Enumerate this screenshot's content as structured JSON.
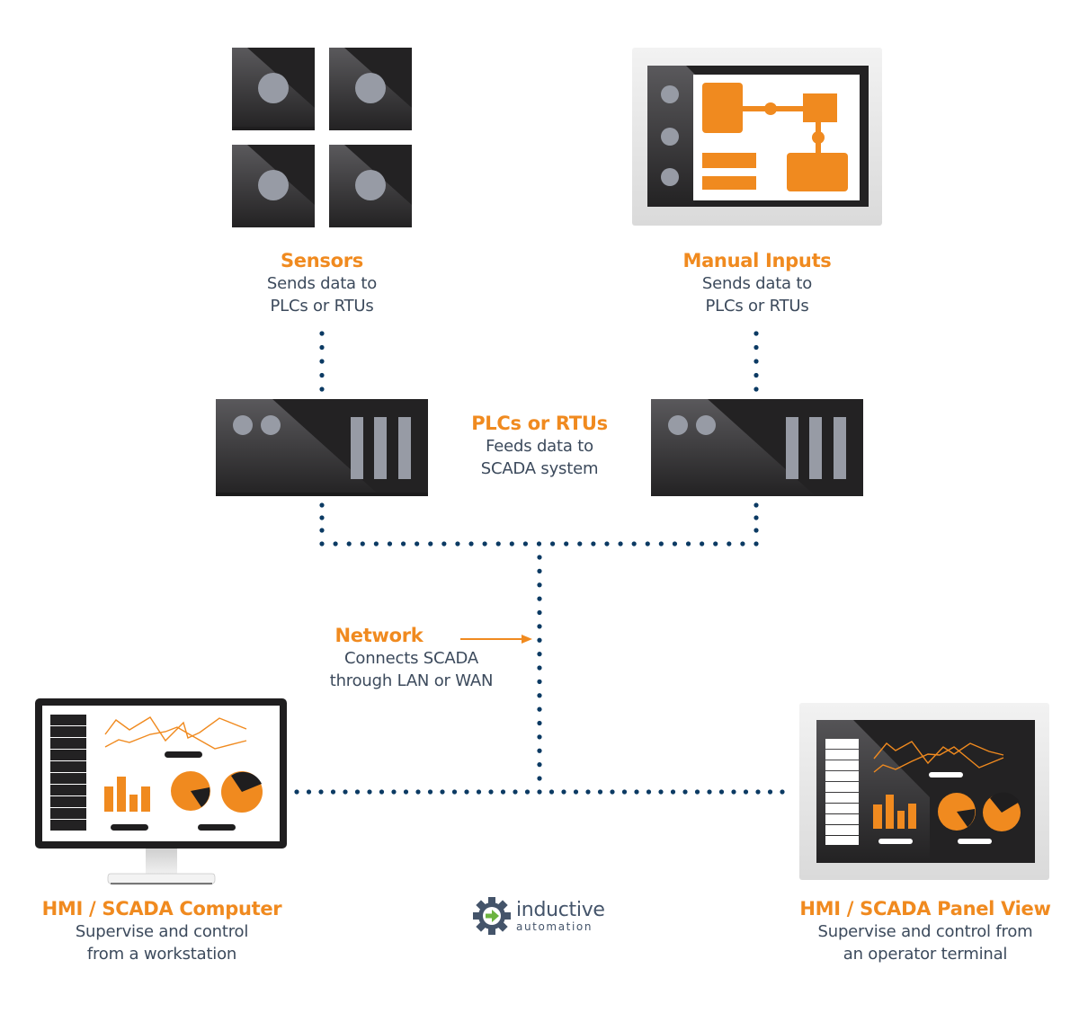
{
  "diagram": {
    "nodes": {
      "sensors": {
        "title": "Sensors",
        "desc_line1": "Sends data to",
        "desc_line2": "PLCs or RTUs"
      },
      "manual_inputs": {
        "title": "Manual Inputs",
        "desc_line1": "Sends data to",
        "desc_line2": "PLCs or RTUs"
      },
      "plcs": {
        "title": "PLCs or RTUs",
        "desc_line1": "Feeds data to",
        "desc_line2": "SCADA system"
      },
      "network": {
        "title": "Network",
        "desc_line1": "Connects SCADA",
        "desc_line2": "through LAN or WAN"
      },
      "hmi_computer": {
        "title": "HMI / SCADA Computer",
        "desc_line1": "Supervise and control",
        "desc_line2": "from a workstation"
      },
      "hmi_panel": {
        "title": "HMI / SCADA Panel View",
        "desc_line1": "Supervise and control from",
        "desc_line2": "an operator terminal"
      }
    },
    "edges": [
      {
        "from": "sensors",
        "to": "plc-left",
        "style": "dotted"
      },
      {
        "from": "manual_inputs",
        "to": "plc-right",
        "style": "dotted"
      },
      {
        "from": "plc-left",
        "to": "network",
        "style": "dotted"
      },
      {
        "from": "plc-right",
        "to": "network",
        "style": "dotted"
      },
      {
        "from": "network",
        "to": "hmi_computer",
        "style": "dotted"
      },
      {
        "from": "network",
        "to": "hmi_panel",
        "style": "dotted"
      }
    ],
    "colors": {
      "accent": "#f08a1f",
      "connector": "#0b3a63",
      "device_dark": "#232223",
      "device_grey": "#979ba5",
      "text": "#3c4a5c"
    }
  },
  "logo": {
    "line1": "inductive",
    "line2": "automation",
    "icon": "gear-arrow-icon"
  }
}
